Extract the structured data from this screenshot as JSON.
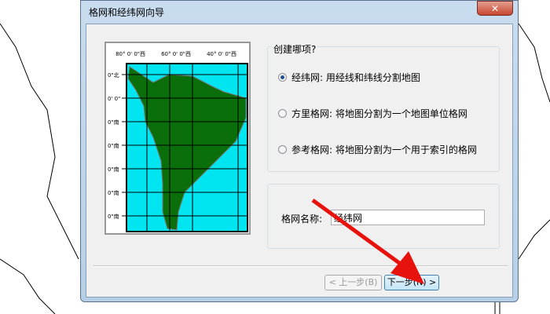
{
  "dialog": {
    "title": "格网和经纬网向导",
    "close_icon": "close-icon"
  },
  "preview": {
    "top_labels": [
      "80° 0' 0\"西",
      "60° 0' 0\"西",
      "40° 0' 0\"西"
    ],
    "left_labels": [
      "0\"北",
      "0' 0\"",
      "0\"南",
      "0\"南",
      "0\"南",
      "0\"南",
      "0\"南"
    ],
    "colors": {
      "ocean": "#00e5f0",
      "land": "#0a6e0a"
    }
  },
  "options": {
    "heading": "创建哪项?",
    "items": [
      {
        "label": "经纬网: 用经线和纬线分割地图",
        "selected": true
      },
      {
        "label": "方里格网: 将地图分割为一个地图单位格网",
        "selected": false
      },
      {
        "label": "参考格网: 将地图分割为一个用于索引的格网",
        "selected": false
      }
    ]
  },
  "name_field": {
    "label": "格网名称:",
    "value": "经纬网"
  },
  "buttons": {
    "back": "< 上一步(B)",
    "next": "下一步(N) >"
  }
}
